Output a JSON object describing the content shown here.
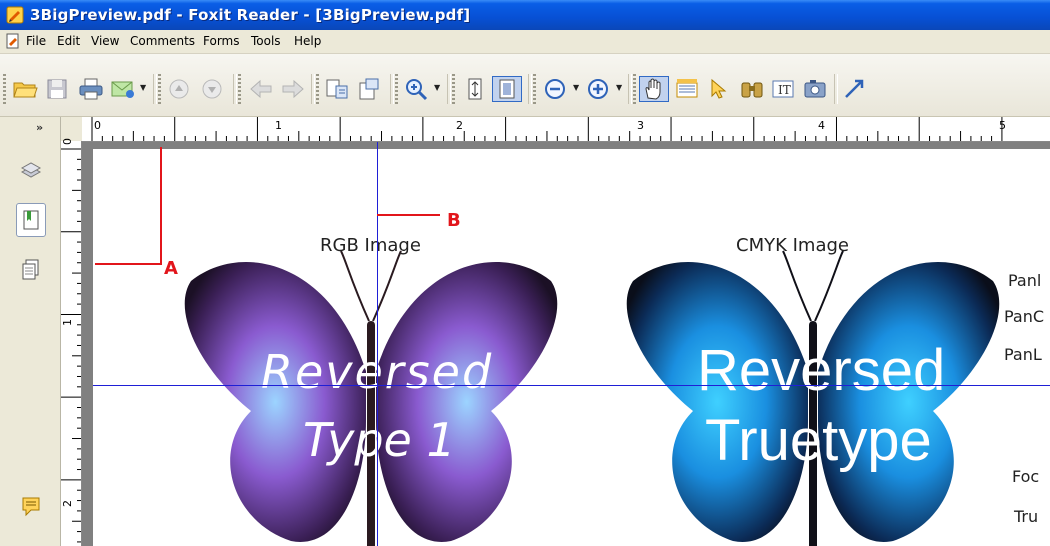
{
  "window": {
    "title": "3BigPreview.pdf - Foxit Reader - [3BigPreview.pdf]"
  },
  "menu": {
    "items": [
      "File",
      "Edit",
      "View",
      "Comments",
      "Forms",
      "Tools",
      "Help"
    ]
  },
  "toolbar": {
    "icons": [
      "open-icon",
      "save-icon",
      "print-icon",
      "email-icon",
      "first-page-icon",
      "next-page-icon",
      "back-icon",
      "forward-icon",
      "extract-text-icon",
      "import-icon",
      "zoom-in-icon",
      "fit-width-icon",
      "fit-page-icon",
      "zoom-out-icon",
      "zoom-in-plus-icon",
      "hand-tool-icon",
      "text-select-icon",
      "select-arrow-icon",
      "binoculars-icon",
      "typewriter-icon",
      "snapshot-icon",
      "arrow-tool-icon"
    ]
  },
  "ruler": {
    "h_labels": [
      "0",
      "1",
      "2",
      "3",
      "4",
      "5"
    ],
    "v_labels": [
      "0",
      "1",
      "2"
    ]
  },
  "document": {
    "rgb_caption": "RGB Image",
    "cmyk_caption": "CMYK Image",
    "rgb_text_1": "Reversed",
    "rgb_text_2": "Type 1",
    "cmyk_text_1": "Reversed",
    "cmyk_text_2": "Truetype",
    "side_texts": [
      "Panl",
      "PanC",
      "PanL",
      "Foc",
      "Tru"
    ]
  },
  "annotations": {
    "a": "A",
    "b": "B"
  },
  "colors": {
    "title_blue": "#0a5ee6",
    "guide_blue": "#1f1fd6",
    "callout_red": "#e2151b",
    "rgb_butterfly": "#8a5bd0",
    "cmyk_butterfly": "#1a8fe0"
  }
}
